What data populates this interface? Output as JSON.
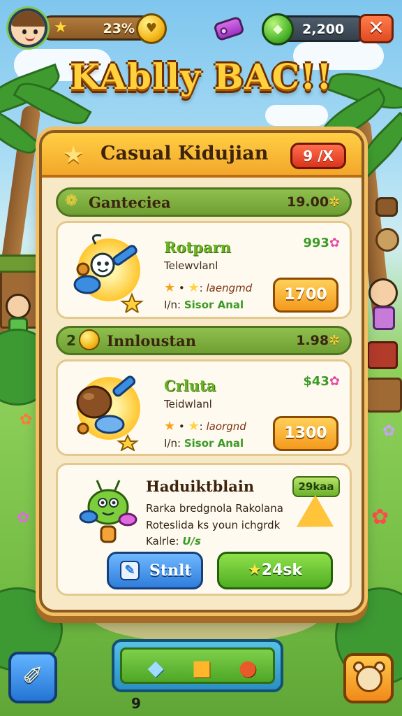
{
  "hud": {
    "xp_value": "23%",
    "gem_value": "2,200",
    "close_symbol": "✕"
  },
  "title": "KAblly BAC!!",
  "panel": {
    "title": "Casual Kidujian",
    "badge": "9 /X"
  },
  "sections": [
    {
      "label": "Ganteciea",
      "price": "19.00",
      "item": {
        "name": "Rotparn",
        "subtitle": "Telewvlanl",
        "rating_label": "laengmd",
        "meta_prefix": "I/n:",
        "meta_value": "Sisor Anal",
        "tag_value": "993",
        "buy_label": "1700"
      }
    },
    {
      "number": "2",
      "label": "Innloustan",
      "price": "1.98",
      "item": {
        "name": "Crluta",
        "subtitle": "Teidwlanl",
        "rating_label": "laorgnd",
        "meta_prefix": "I/n:",
        "meta_value": "Sisor Anal",
        "tag_value": "$43",
        "buy_label": "1300"
      }
    }
  ],
  "featured": {
    "name": "Haduiktblain",
    "tag": "29kaa",
    "desc_line1": "Rarka bredgnola Rakolana",
    "desc_line2": "Roteslida ks youn ichgrdk",
    "key_label": "Kalrle:",
    "key_value": "U/s"
  },
  "buttons": {
    "start_label": "Stnlt",
    "reward_label": "24sk"
  },
  "bottom": {
    "counter": "9"
  },
  "colors": {
    "accent_orange": "#f39a1d",
    "accent_green": "#6fb22a",
    "panel_bg": "#f8e9c6",
    "title_yellow": "#ffd23d"
  }
}
